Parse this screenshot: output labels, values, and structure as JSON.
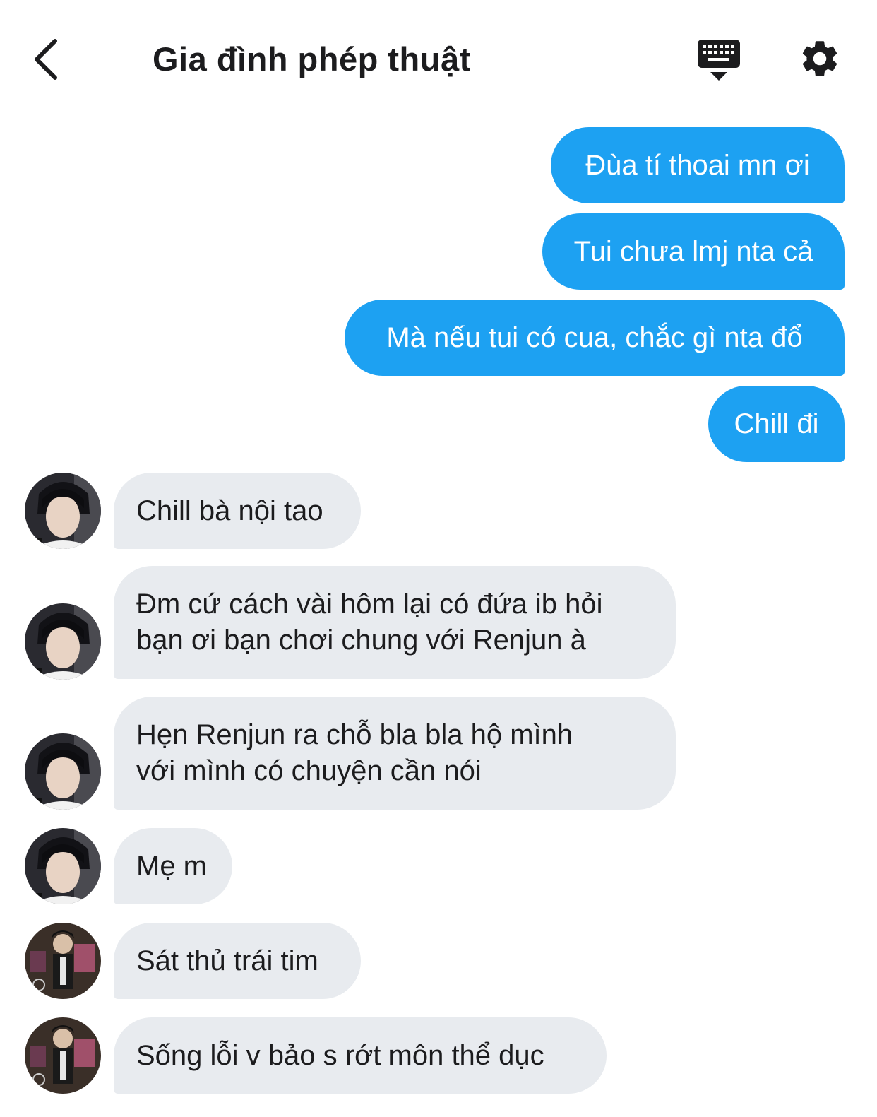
{
  "header": {
    "title": "Gia đình phép thuật",
    "back_icon": "chevron-left-icon",
    "keyboard_icon": "keyboard-icon",
    "settings_icon": "gear-icon"
  },
  "colors": {
    "outgoing_bubble": "#1da1f2",
    "incoming_bubble": "#e8ebef",
    "text_dark": "#1c1c1e"
  },
  "messages": [
    {
      "direction": "outgoing",
      "text": "Đùa tí thoai mn ơi"
    },
    {
      "direction": "outgoing",
      "text": "Tui chưa lmj nta cả"
    },
    {
      "direction": "outgoing",
      "text": "Mà nếu tui có cua, chắc gì nta đổ"
    },
    {
      "direction": "outgoing",
      "text": "Chill đi"
    },
    {
      "direction": "incoming",
      "sender_avatar": "avatar-user-a",
      "text": "Chill bà nội tao"
    },
    {
      "direction": "incoming",
      "sender_avatar": "avatar-user-a",
      "text": "Đm cứ cách vài hôm lại có đứa ib hỏi\nbạn ơi bạn chơi chung với Renjun à"
    },
    {
      "direction": "incoming",
      "sender_avatar": "avatar-user-a",
      "text": "Hẹn Renjun ra chỗ bla bla hộ mình\nvới mình có chuyện cần nói"
    },
    {
      "direction": "incoming",
      "sender_avatar": "avatar-user-a",
      "text": "Mẹ m"
    },
    {
      "direction": "incoming",
      "sender_avatar": "avatar-user-b",
      "text": "Sát thủ trái tim"
    },
    {
      "direction": "incoming",
      "sender_avatar": "avatar-user-b",
      "text": "Sống lỗi v bảo s rớt môn thể dục"
    }
  ]
}
